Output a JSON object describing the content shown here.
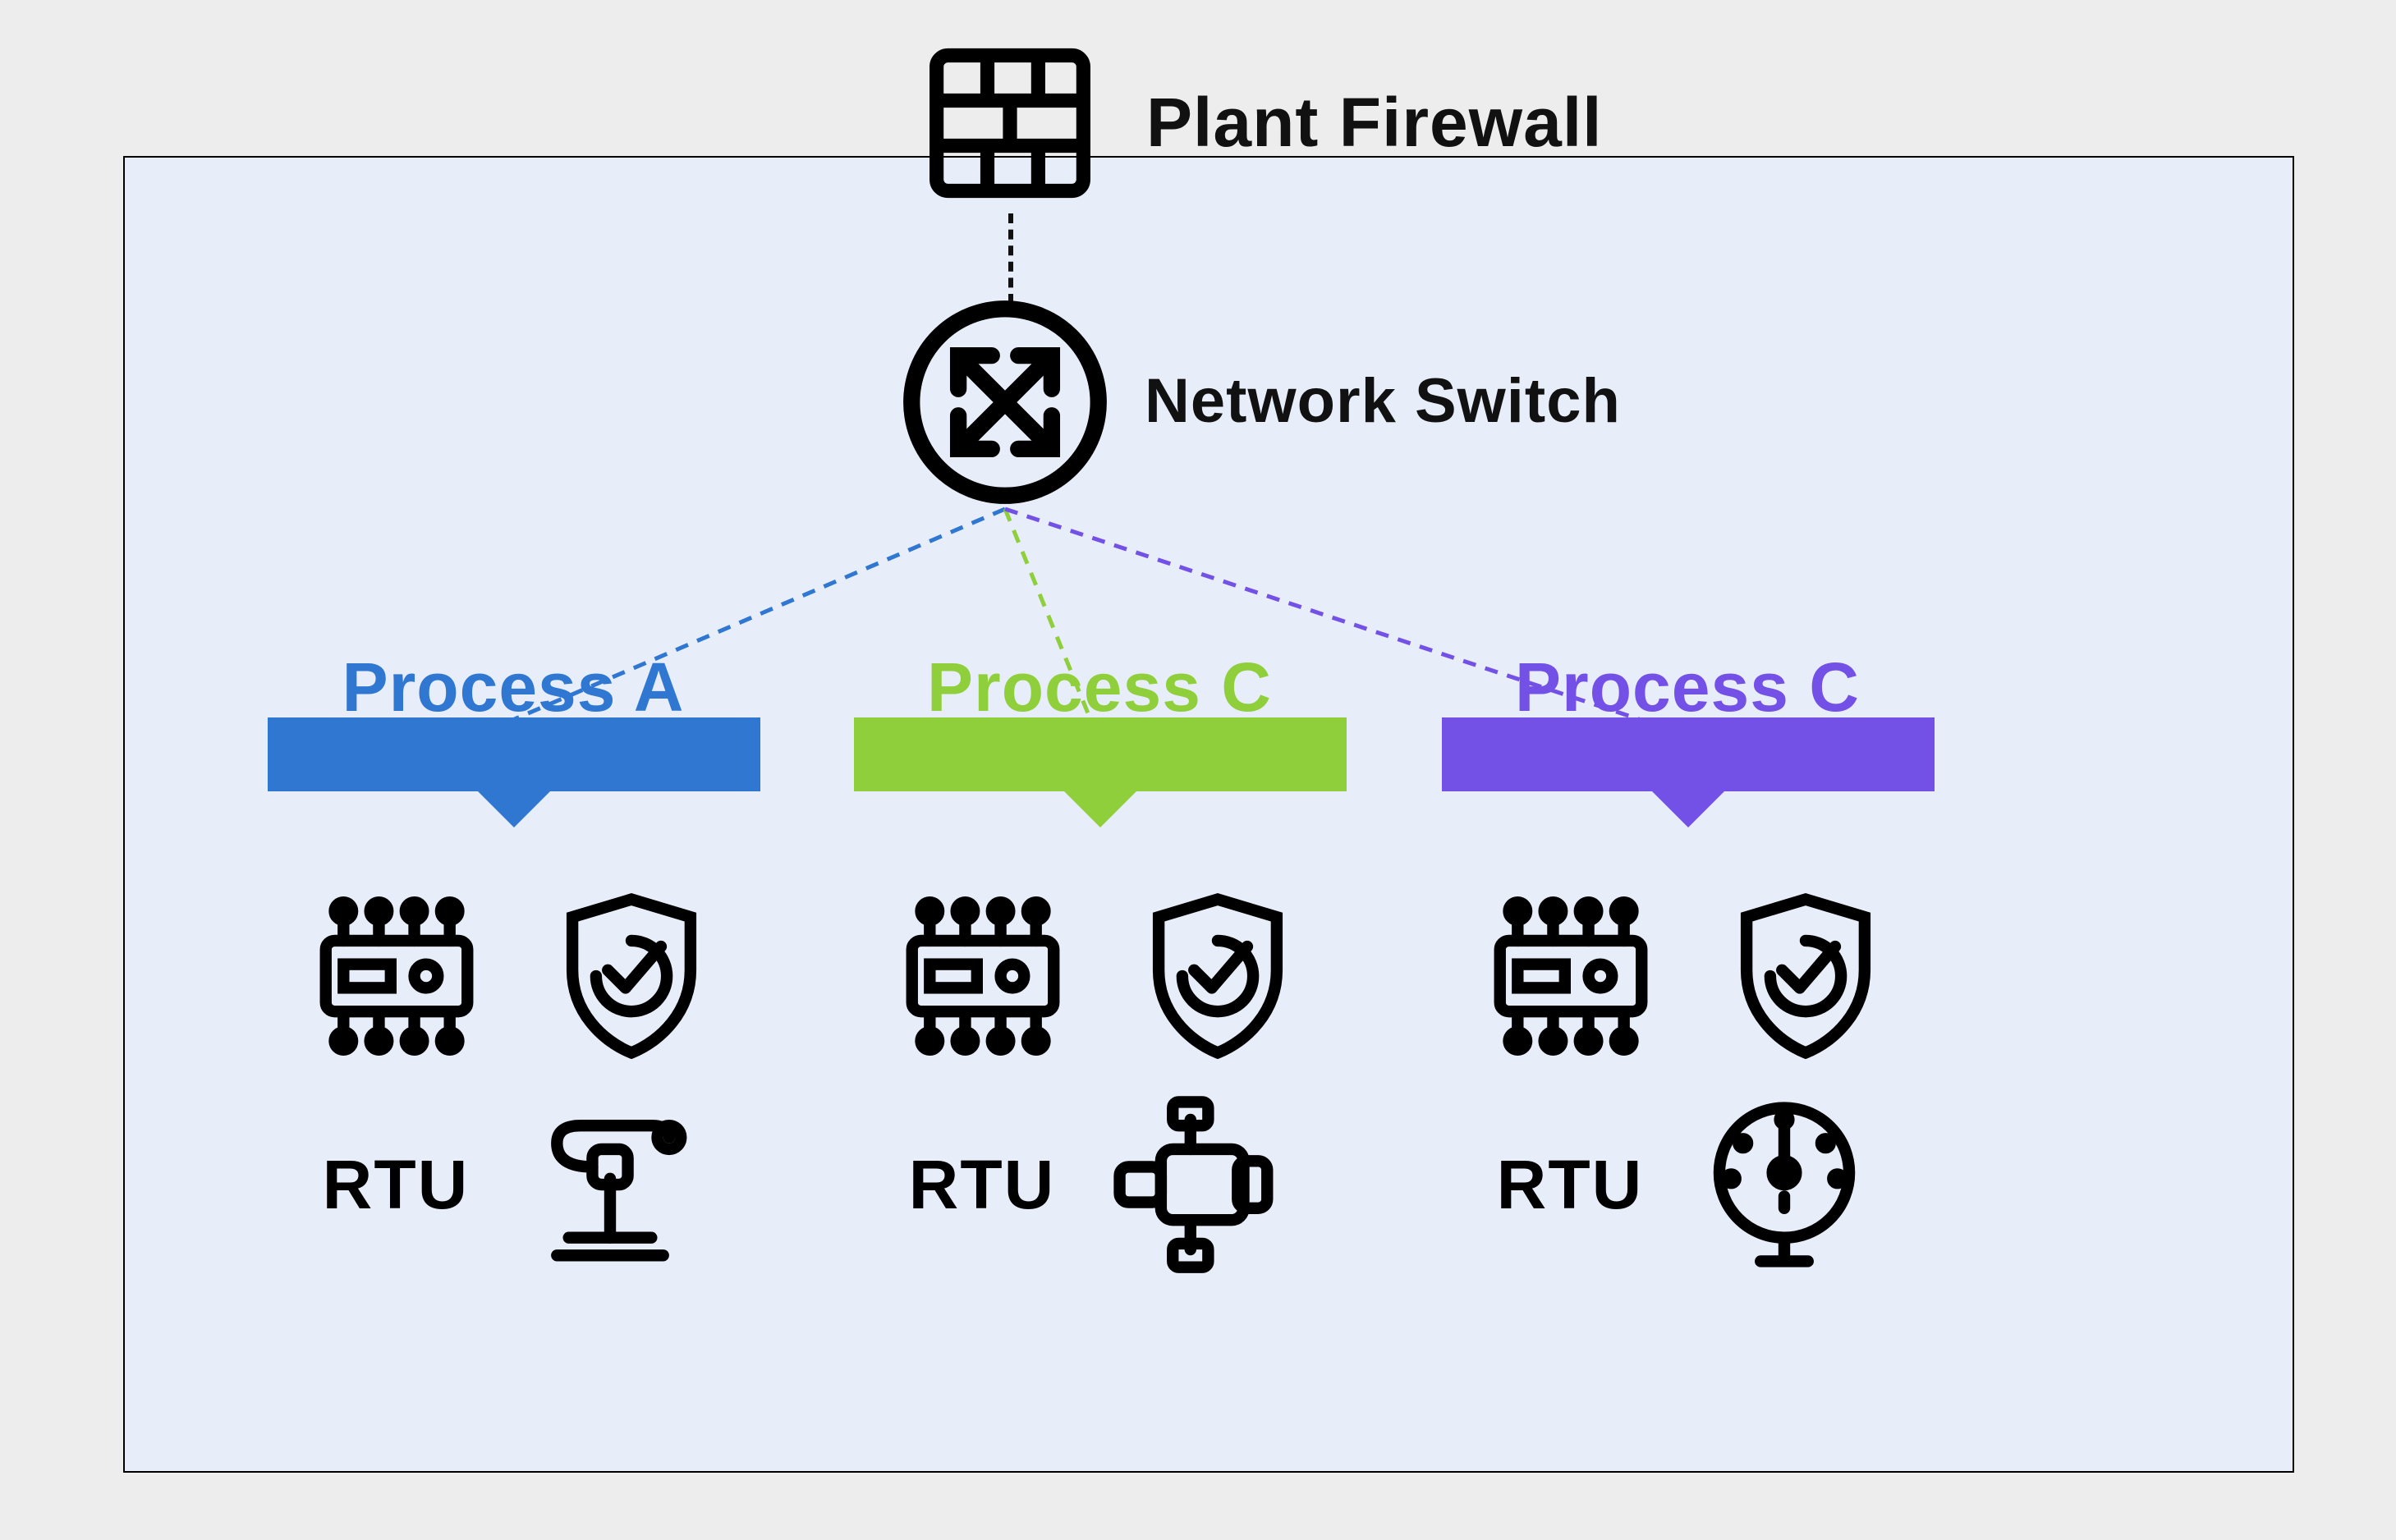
{
  "top": {
    "firewall_label": "Plant Firewall",
    "switch_label": "Network Switch"
  },
  "processes": [
    {
      "label": "Process A",
      "color": "#2f77d1",
      "rtu": "RTU"
    },
    {
      "label": "Process C",
      "color": "#8fcf3b",
      "rtu": "RTU"
    },
    {
      "label": "Process C",
      "color": "#7351e6",
      "rtu": "RTU"
    }
  ],
  "chart_data": {
    "type": "network-diagram",
    "nodes": [
      {
        "id": "firewall",
        "label": "Plant Firewall",
        "type": "firewall"
      },
      {
        "id": "switch",
        "label": "Network Switch",
        "type": "switch"
      },
      {
        "id": "procA",
        "label": "Process A",
        "type": "process",
        "color": "#2f77d1",
        "children": [
          "PLC",
          "Safety Shield",
          "RTU",
          "Valve Actuator"
        ]
      },
      {
        "id": "procB",
        "label": "Process C",
        "type": "process",
        "color": "#8fcf3b",
        "children": [
          "PLC",
          "Safety Shield",
          "RTU",
          "Pump"
        ]
      },
      {
        "id": "procC",
        "label": "Process C",
        "type": "process",
        "color": "#7351e6",
        "children": [
          "PLC",
          "Safety Shield",
          "RTU",
          "Gauge"
        ]
      }
    ],
    "edges": [
      {
        "from": "firewall",
        "to": "switch",
        "style": "dashed"
      },
      {
        "from": "switch",
        "to": "procA",
        "style": "dashed",
        "color": "#2f77d1"
      },
      {
        "from": "switch",
        "to": "procB",
        "style": "dashed",
        "color": "#8fcf3b"
      },
      {
        "from": "switch",
        "to": "procC",
        "style": "dashed",
        "color": "#7351e6"
      }
    ]
  }
}
